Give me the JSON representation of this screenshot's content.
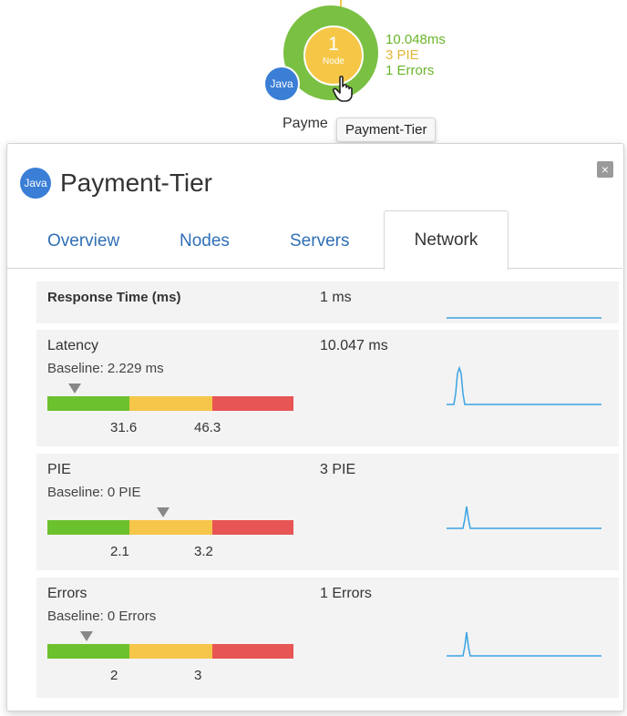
{
  "node": {
    "count": "1",
    "label": "Node",
    "badge": "Java",
    "name_partial": "Payme",
    "tooltip": "Payment-Tier",
    "stats": [
      "10.048ms",
      "3 PIE",
      "1 Errors"
    ]
  },
  "panel": {
    "badge": "Java",
    "title": "Payment-Tier",
    "close_icon": "×",
    "tabs": [
      "Overview",
      "Nodes",
      "Servers",
      "Network"
    ],
    "active_tab": "Network"
  },
  "metrics": {
    "response_time": {
      "name": "Response Time (ms)",
      "value": "1 ms"
    },
    "latency": {
      "name": "Latency",
      "value": "10.047 ms",
      "baseline": "Baseline: 2.229 ms",
      "thresholds": [
        "31.6",
        "46.3"
      ],
      "marker_fraction": 0.11
    },
    "pie": {
      "name": "PIE",
      "value": "3 PIE",
      "baseline": "Baseline: 0 PIE",
      "thresholds": [
        "2.1",
        "3.2"
      ],
      "marker_fraction": 0.47
    },
    "errors": {
      "name": "Errors",
      "value": "1 Errors",
      "baseline": "Baseline: 0 Errors",
      "thresholds": [
        "2",
        "3"
      ],
      "marker_fraction": 0.16
    }
  },
  "colors": {
    "good": "#6cc12e",
    "warning": "#f6c64a",
    "critical": "#e85555",
    "accent": "#2f6fb6",
    "sparkline": "#3aa3e3"
  },
  "icons": {
    "cursor": "hand-pointer-icon",
    "close": "close-icon"
  }
}
